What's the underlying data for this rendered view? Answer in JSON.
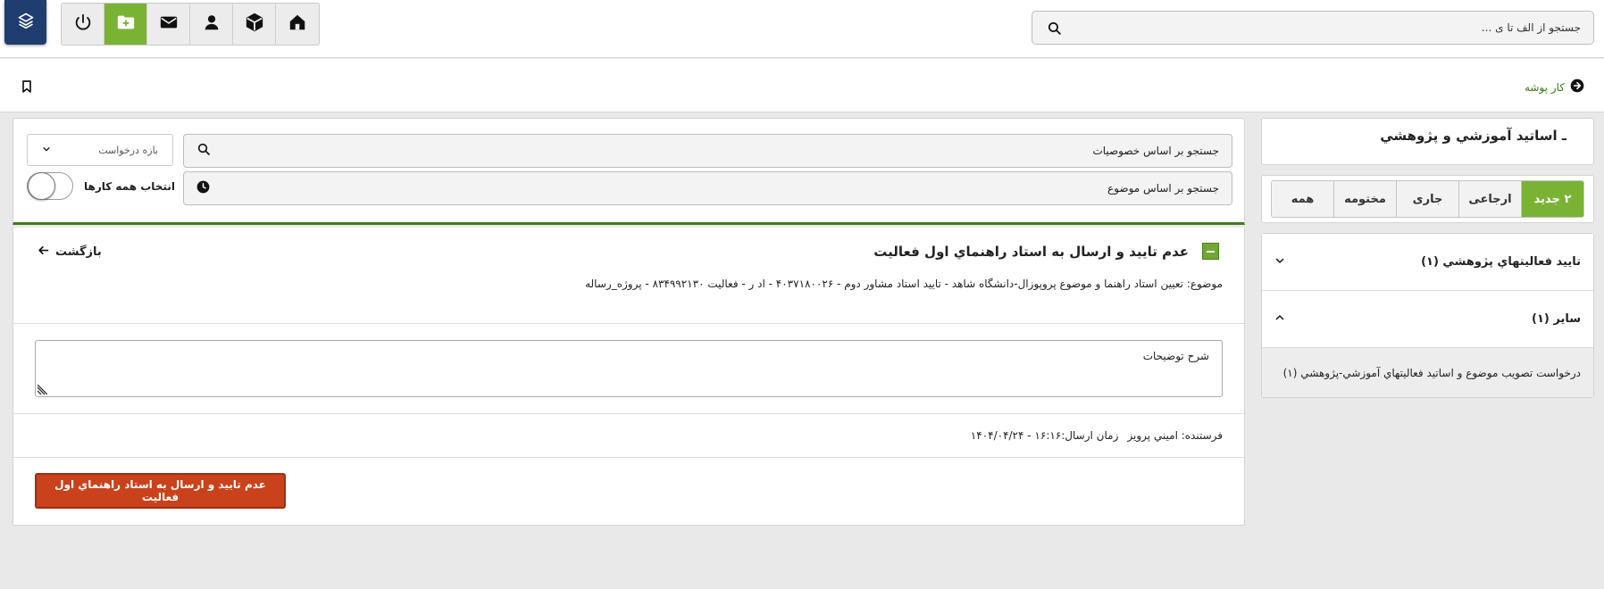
{
  "header": {
    "search_placeholder": "جستجو از الف تا ی ..."
  },
  "breadcrumb": {
    "label": "کار پوشه"
  },
  "right_panel": {
    "title": "ـ اساتيد آموزشي و پژوهشي",
    "tabs": [
      {
        "label": "۲ جدید",
        "active": true
      },
      {
        "label": "ارجاعی",
        "active": false
      },
      {
        "label": "جاری",
        "active": false
      },
      {
        "label": "مختومه",
        "active": false
      },
      {
        "label": "همه",
        "active": false
      }
    ],
    "groups": [
      {
        "label": "تاييد فعاليتهاي پژوهشي (۱)",
        "expanded": false
      },
      {
        "label": "ساير (۱)",
        "expanded": true
      }
    ],
    "sub_item": "درخواست تصويب موضوع و اساتيد فعاليتهاي آموزشي-پژوهشي (۱)"
  },
  "filters": {
    "search_by_attributes": "جستجو بر اساس خصوصیات",
    "search_by_subject": "جستجو بر اساس موضوع",
    "range_select": "بازه درخواست",
    "select_all_label": "انتخاب همه کارها"
  },
  "detail": {
    "title": "عدم تاييد و ارسال به استاد راهنماي اول فعاليت",
    "back_label": "بازگشت",
    "subject": "موضوع: تعيين استاد راهنما و موضوع پروپوزال-دانشگاه شاهد - تاييد استاد مشاور دوم - ۴۰۳۷۱۸۰۰۲۶ - اد        ر - فعاليت ۸۳۴۹۹۲۱۳۰ - پروژه_رساله",
    "description_placeholder": "شرح توضیحات",
    "sender_label": "فرستنده: اميني پرويز",
    "send_time_label": "زمان ارسال:۱۶:۱۶ - ۱۴۰۴/۰۴/۲۴",
    "action_button": "عدم تاييد و ارسال به استاد راهنماي اول فعاليت"
  },
  "colors": {
    "accent_green": "#7ab334",
    "dark_green": "#3f7b1c",
    "danger": "#c9421b",
    "logo_bg": "#1f3d6e"
  },
  "icons": [
    "layers-icon",
    "power-icon",
    "folder-plus-icon",
    "mail-icon",
    "user-icon",
    "cube-icon",
    "home-icon",
    "search-icon",
    "bookmark-icon",
    "arrow-circle-right-icon",
    "clock-icon",
    "chevron-down-icon",
    "chevron-up-icon",
    "arrow-left-icon"
  ]
}
